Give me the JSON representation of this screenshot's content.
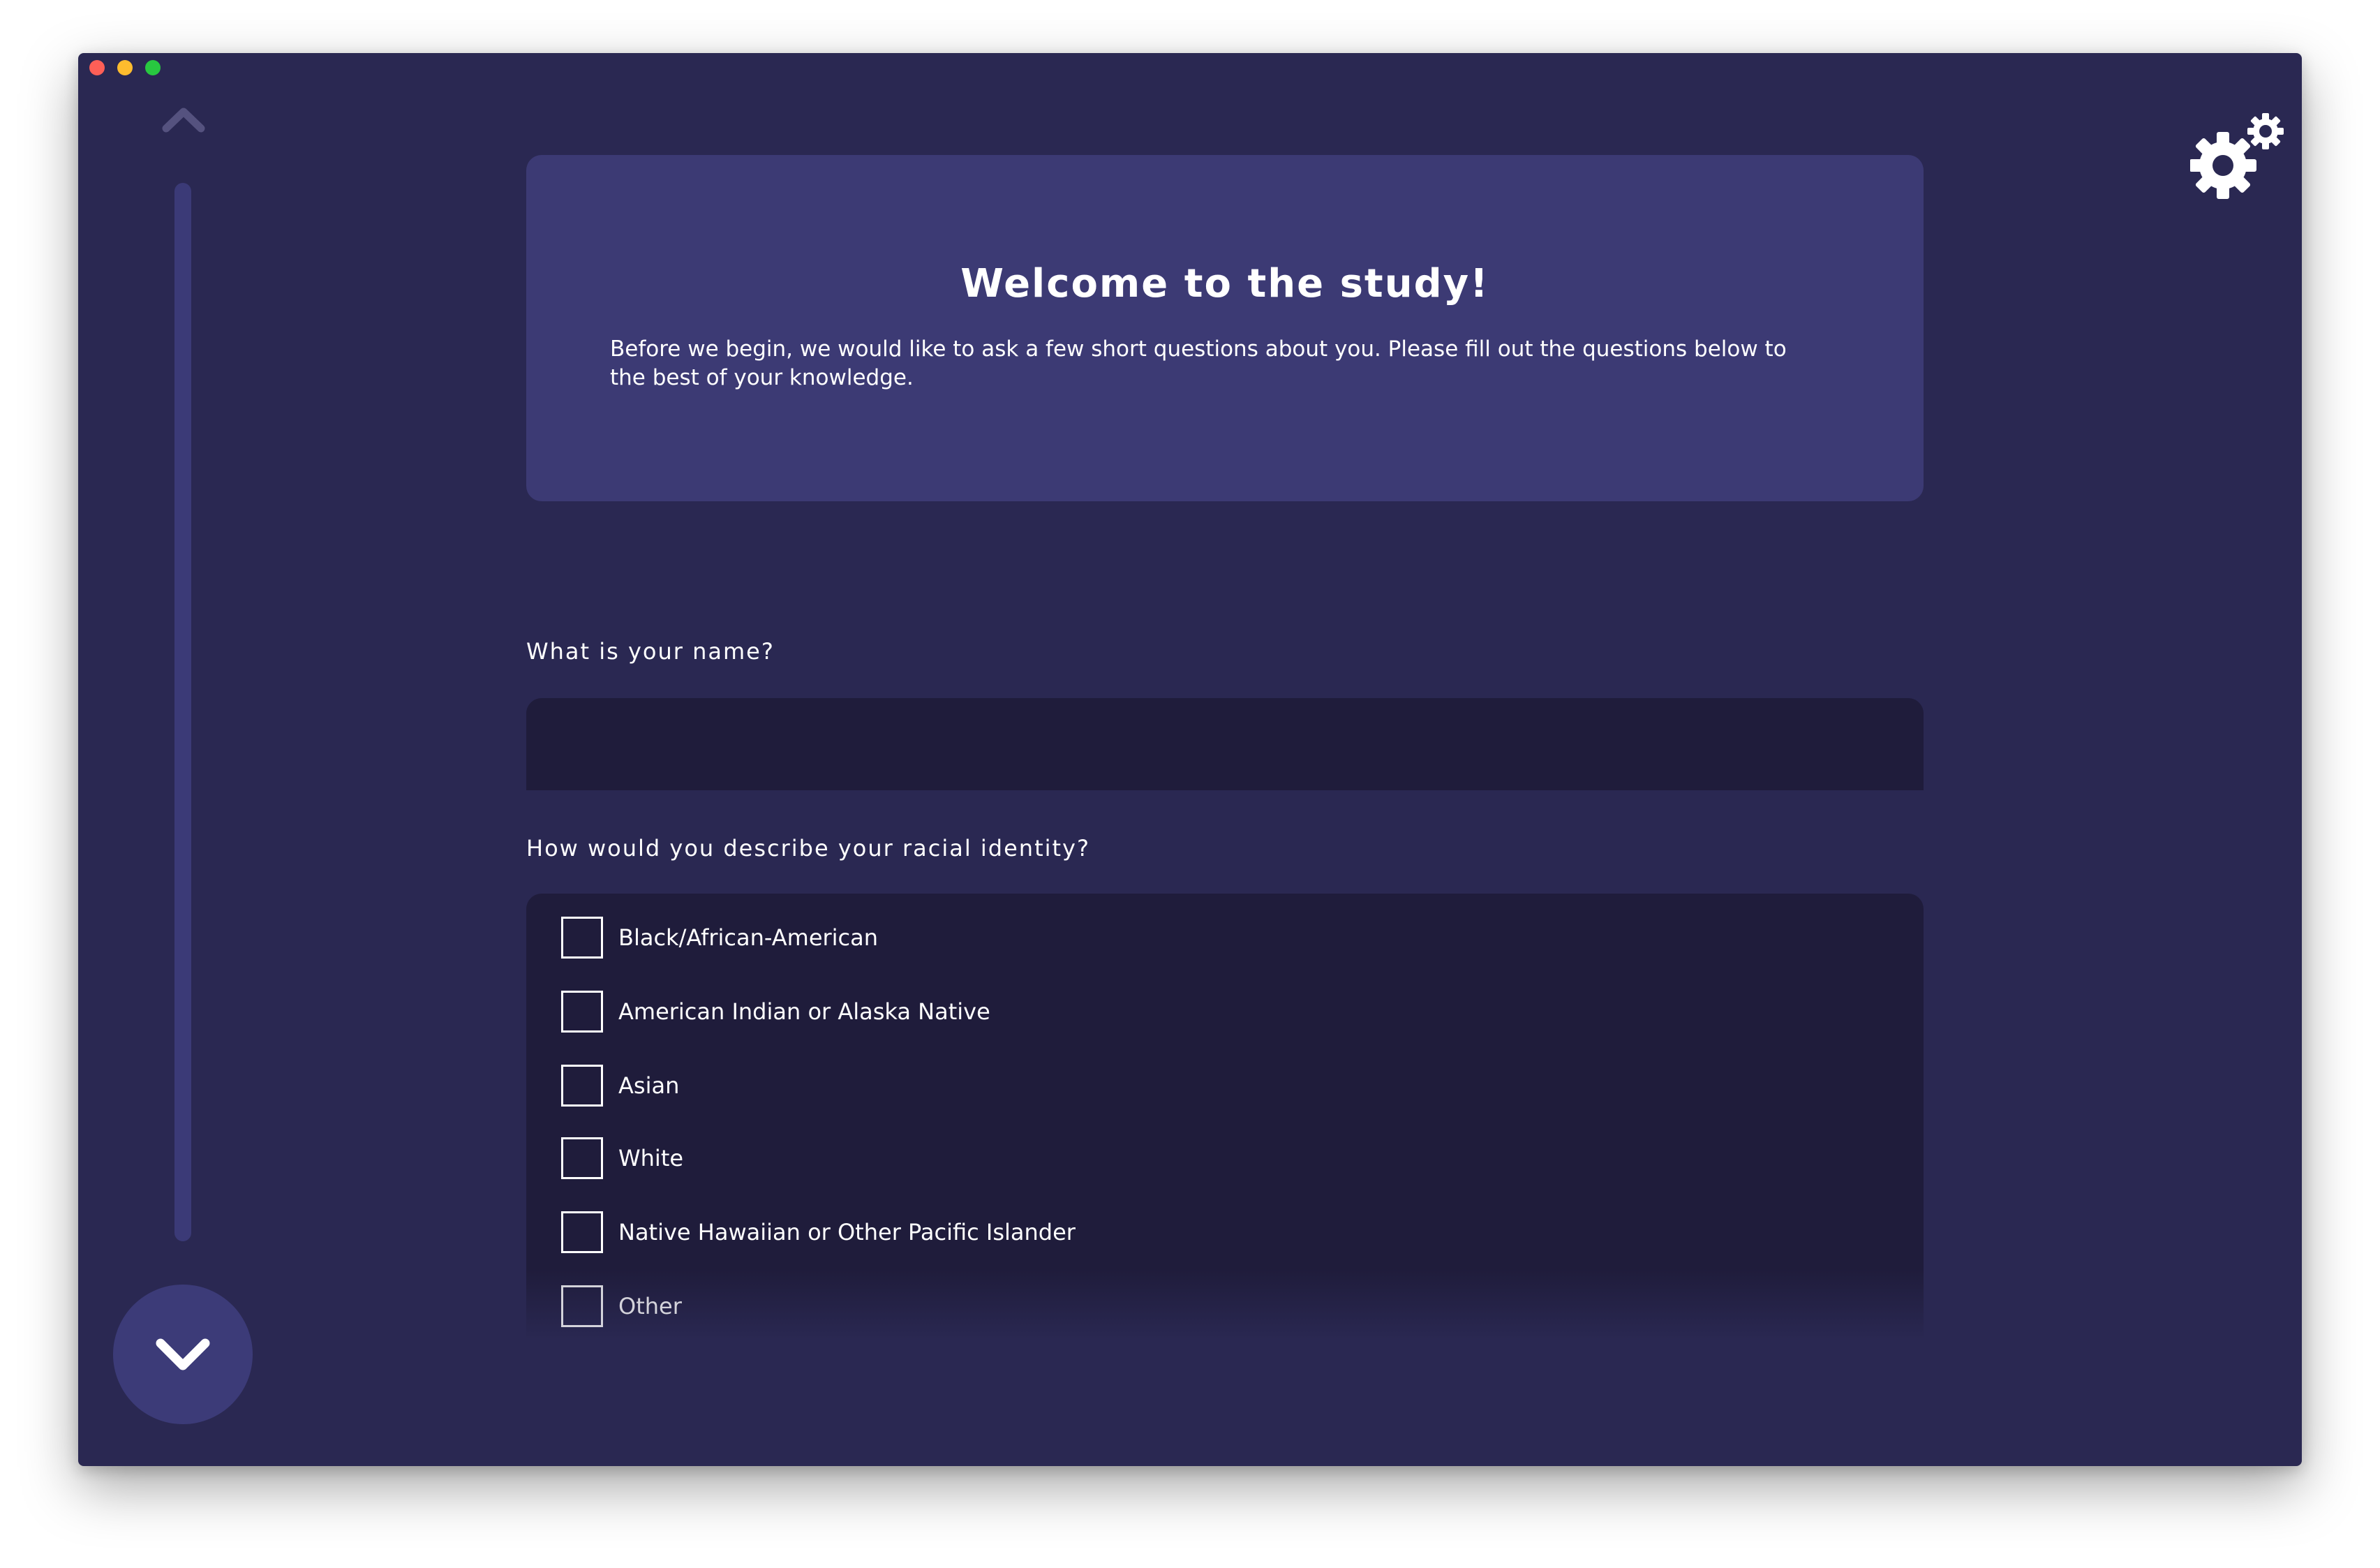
{
  "card": {
    "title": "Welcome to the study!",
    "intro": "Before we begin, we would like to ask a few short questions about you. Please fill out the questions below to the best of your knowledge."
  },
  "questions": {
    "name": {
      "label": "What is your name?",
      "value": "",
      "placeholder": ""
    },
    "race": {
      "label": "How would you describe your racial identity?",
      "options": [
        {
          "label": "Black/African-American",
          "checked": false
        },
        {
          "label": "American Indian or Alaska Native",
          "checked": false
        },
        {
          "label": "Asian",
          "checked": false
        },
        {
          "label": "White",
          "checked": false
        },
        {
          "label": "Native Hawaiian or Other Pacific Islander",
          "checked": false
        },
        {
          "label": "Other",
          "checked": false
        }
      ]
    }
  },
  "navigation": {
    "up_icon": "chevron-up-icon",
    "down_icon": "chevron-down-icon",
    "settings_icon": "gears-icon"
  },
  "colors": {
    "window_bg": "#2a2852",
    "card_bg": "#3c3a74",
    "field_bg": "#1f1c3b",
    "scroll_track": "#3b3a77",
    "text": "#ffffff"
  }
}
